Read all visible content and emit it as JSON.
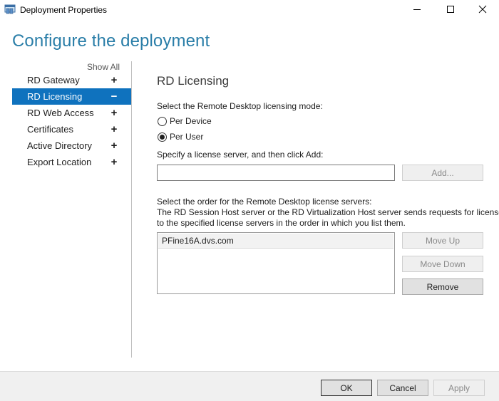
{
  "window": {
    "title": "Deployment Properties",
    "app_icon": "server-window-icon",
    "controls": {
      "minimize": "minimize-icon",
      "maximize": "maximize-icon",
      "close": "close-icon"
    }
  },
  "page_heading": "Configure the deployment",
  "nav": {
    "show_all": "Show All",
    "items": [
      {
        "label": "RD Gateway",
        "sign": "+"
      },
      {
        "label": "RD Licensing",
        "sign": "−",
        "selected": true
      },
      {
        "label": "RD Web Access",
        "sign": "+"
      },
      {
        "label": "Certificates",
        "sign": "+"
      },
      {
        "label": "Active Directory",
        "sign": "+"
      },
      {
        "label": "Export Location",
        "sign": "+"
      }
    ]
  },
  "licensing": {
    "title": "RD Licensing",
    "mode_prompt": "Select the Remote Desktop licensing mode:",
    "modes": [
      {
        "label": "Per Device",
        "checked": false
      },
      {
        "label": "Per User",
        "checked": true
      }
    ],
    "server_prompt": "Specify a license server, and then click Add:",
    "server_input_value": "",
    "add_button": "Add...",
    "order_prompt_line1": "Select the order for the Remote Desktop license servers:",
    "order_prompt_line2": "The RD Session Host server or the RD Virtualization Host server sends requests for licenses",
    "order_prompt_line3": "to the specified license servers in the order in which you list them.",
    "servers": [
      "PFine16A.dvs.com"
    ],
    "move_up_button": "Move Up",
    "move_down_button": "Move Down",
    "remove_button": "Remove"
  },
  "footer": {
    "ok": "OK",
    "cancel": "Cancel",
    "apply": "Apply"
  },
  "colors": {
    "heading": "#2a7ea8",
    "selected_nav": "#0f72be"
  }
}
